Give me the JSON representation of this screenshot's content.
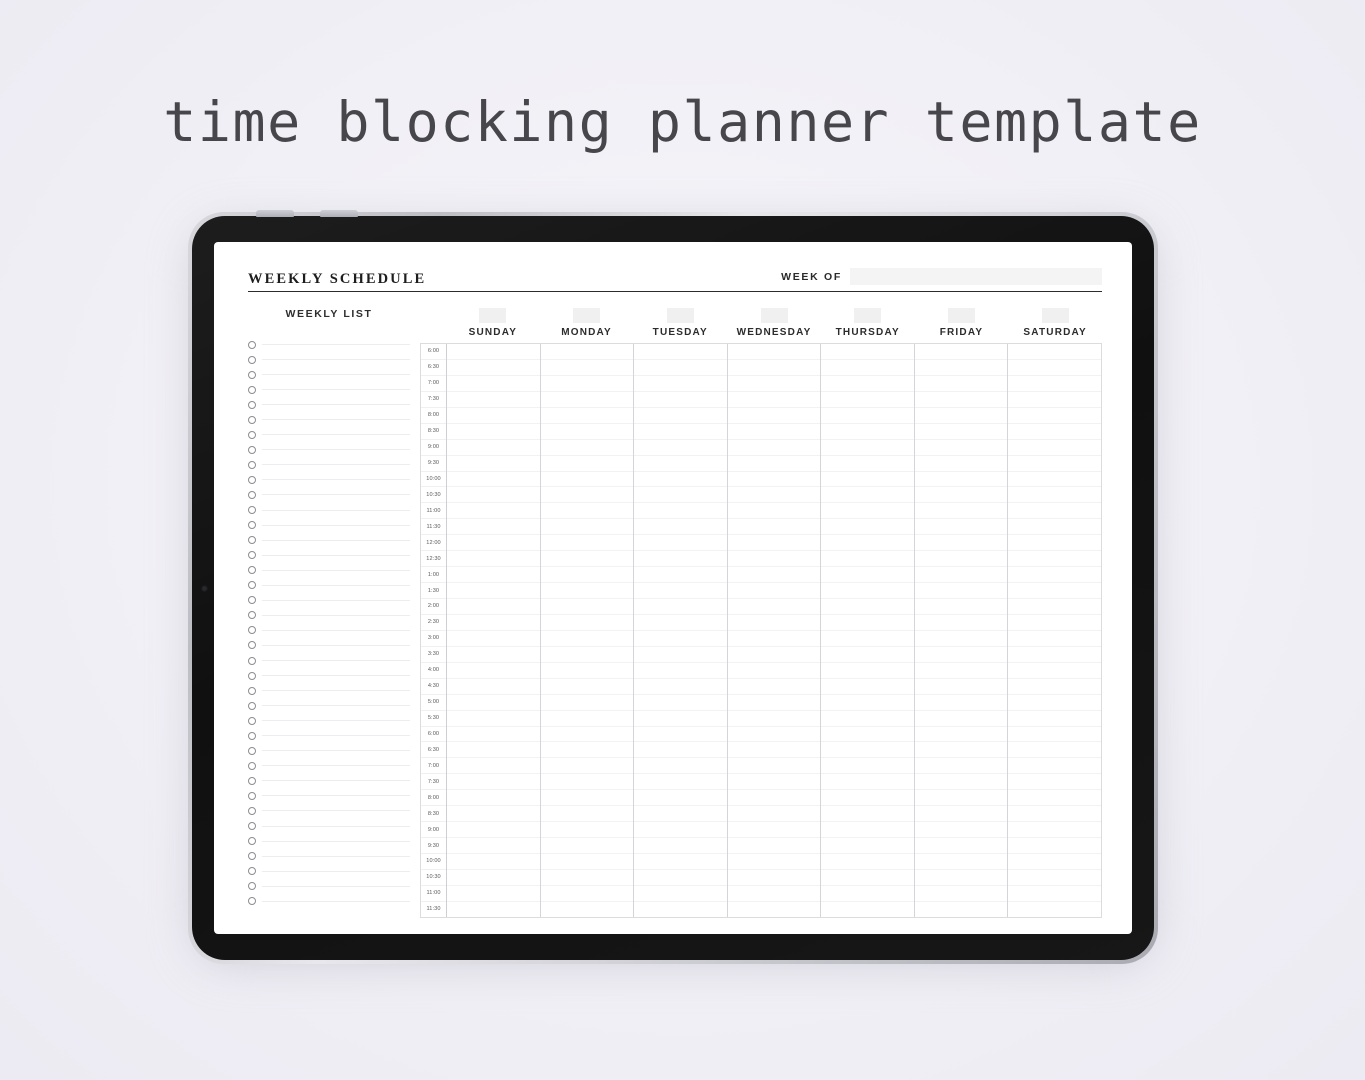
{
  "headline": "time blocking planner template",
  "planner": {
    "title": "WEEKLY SCHEDULE",
    "week_of_label": "WEEK OF",
    "week_of_value": "",
    "weekly_list": {
      "title": "WEEKLY LIST",
      "row_count": 38,
      "items": [
        "",
        "",
        "",
        "",
        "",
        "",
        "",
        "",
        "",
        "",
        "",
        "",
        "",
        "",
        "",
        "",
        "",
        "",
        "",
        "",
        "",
        "",
        "",
        "",
        "",
        "",
        "",
        "",
        "",
        "",
        "",
        "",
        "",
        "",
        "",
        "",
        "",
        ""
      ]
    },
    "days": [
      {
        "name": "SUNDAY",
        "date": ""
      },
      {
        "name": "MONDAY",
        "date": ""
      },
      {
        "name": "TUESDAY",
        "date": ""
      },
      {
        "name": "WEDNESDAY",
        "date": ""
      },
      {
        "name": "THURSDAY",
        "date": ""
      },
      {
        "name": "FRIDAY",
        "date": ""
      },
      {
        "name": "SATURDAY",
        "date": ""
      }
    ],
    "times": [
      "6:00",
      "6:30",
      "7:00",
      "7:30",
      "8:00",
      "8:30",
      "9:00",
      "9:30",
      "10:00",
      "10:30",
      "11:00",
      "11:30",
      "12:00",
      "12:30",
      "1:00",
      "1:30",
      "2:00",
      "2:30",
      "3:00",
      "3:30",
      "4:00",
      "4:30",
      "5:00",
      "5:30",
      "6:00",
      "6:30",
      "7:00",
      "7:30",
      "8:00",
      "8:30",
      "9:00",
      "9:30",
      "10:00",
      "10:30",
      "11:00",
      "11:30"
    ]
  },
  "colors": {
    "backdrop": "#f2f1f6",
    "page": "#ffffff",
    "ink": "#1d1d1d",
    "rule": "#2d2d2d",
    "field_fill": "#f4f4f5",
    "date_box": "#f0f0f1",
    "grid_line": "#f2f2f4",
    "col_line": "#d5d5d9",
    "device_bezel": "#141414",
    "device_frame": "#c9c9d0"
  }
}
